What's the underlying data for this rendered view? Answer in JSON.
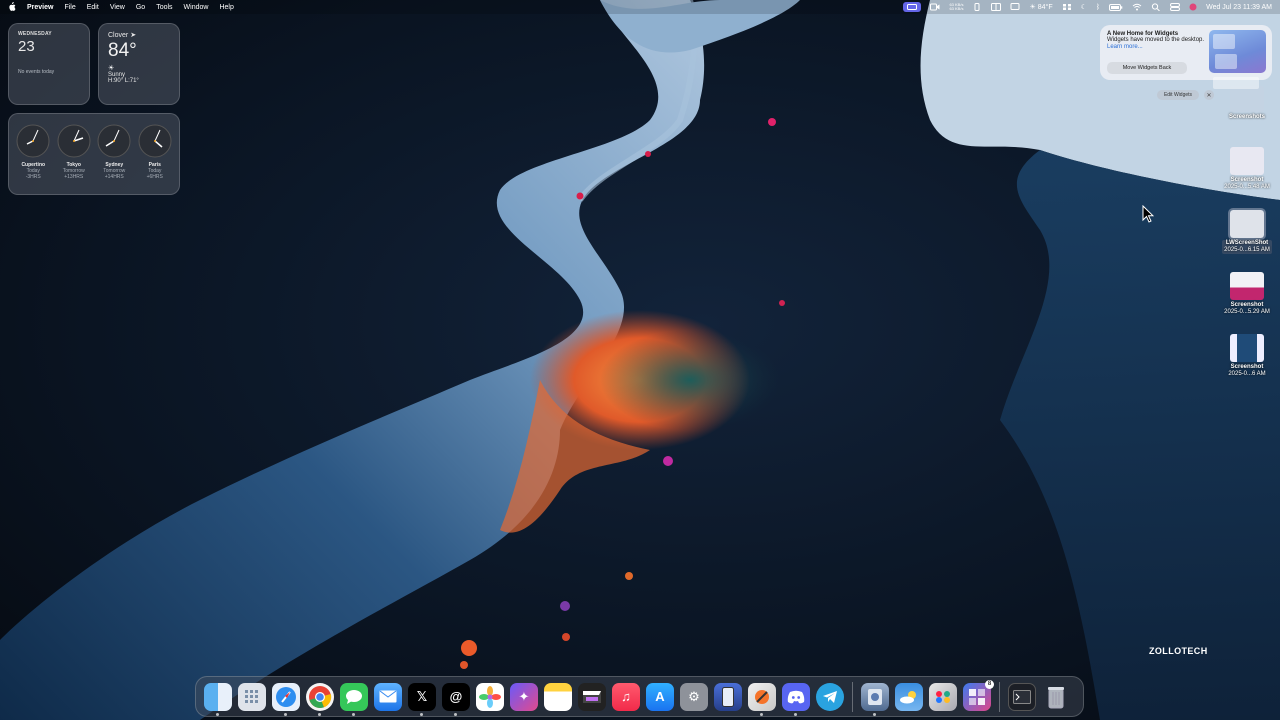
{
  "menubar": {
    "apple_icon": "apple-icon",
    "app_name": "Preview",
    "menus": [
      "File",
      "Edit",
      "View",
      "Go",
      "Tools",
      "Window",
      "Help"
    ],
    "net_up": "63 KB/s",
    "net_down": "63 KB/s",
    "weather": "84°F",
    "datetime": "Wed Jul 23  11:39 AM"
  },
  "widgets": {
    "calendar": {
      "day": "WEDNESDAY",
      "date": "23",
      "events": "No events today"
    },
    "weather": {
      "location": "Clover",
      "temp": "84°",
      "condition": "Sunny",
      "hilo": "H:90° L:71°"
    },
    "clocks": [
      {
        "city": "Cupertino",
        "day": "Today",
        "offset": "-3HRS"
      },
      {
        "city": "Tokyo",
        "day": "Tomorrow",
        "offset": "+13HRS"
      },
      {
        "city": "Sydney",
        "day": "Tomorrow",
        "offset": "+14HRS"
      },
      {
        "city": "Paris",
        "day": "Today",
        "offset": "+6HRS"
      }
    ]
  },
  "notification": {
    "title": "A New Home for Widgets",
    "body": "Widgets have moved to the desktop.",
    "link": "Learn more...",
    "button": "Move Widgets Back"
  },
  "edit_widgets": "Edit Widgets",
  "desktop_icons": [
    {
      "line1": "Screenshots",
      "line2": ""
    },
    {
      "line1": "Screenshot",
      "line2": "2025-0...5.48 AM"
    },
    {
      "line1": "LWScreenShot",
      "line2": "2025-0...6.15 AM"
    },
    {
      "line1": "Screenshot",
      "line2": "2025-0...5.29 AM"
    },
    {
      "line1": "Screenshot",
      "line2": "2025-0...6 AM"
    }
  ],
  "watermark": "ZOLLOTECH",
  "dock": {
    "apps": [
      "Finder",
      "Launchpad",
      "Safari",
      "Chrome",
      "Messages",
      "Mail",
      "X",
      "Threads",
      "Photos",
      "Craft",
      "Notes",
      "Final Cut Pro",
      "Music",
      "App Store",
      "System Settings",
      "Simulator",
      "Pixelmator",
      "Discord",
      "Telegram",
      "Disk Utility",
      "Weather",
      "Games",
      "Mosaic",
      "Terminal",
      "Trash"
    ],
    "badge": "8"
  },
  "colors": {
    "accent": "#6466e8",
    "wallpaper_light": "#a6c4df",
    "wallpaper_orange": "#f07d3c",
    "wallpaper_dark": "#0b1522"
  }
}
